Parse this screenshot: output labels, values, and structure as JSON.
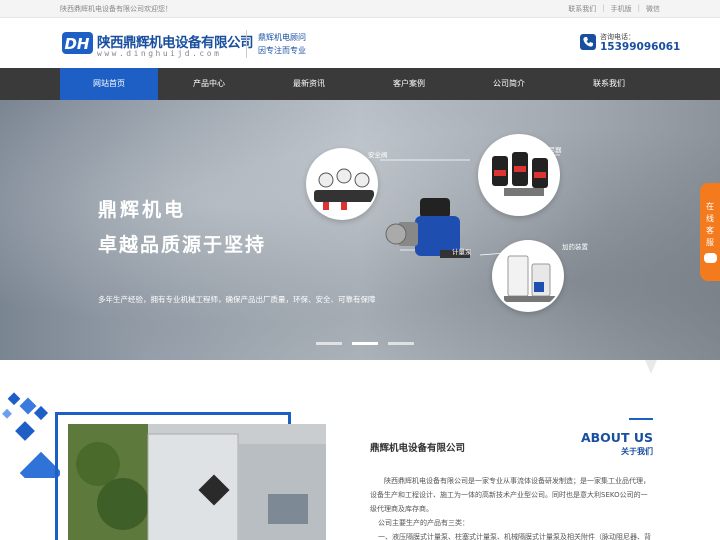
{
  "topbar": {
    "welcome": "陕西鼎辉机电设备有限公司欢迎您！",
    "links": [
      "联系我们",
      "手机版",
      "微信"
    ]
  },
  "header": {
    "brand_cn": "陕西鼎辉机电设备有限公司",
    "brand_en": "www.dinghuijd.com",
    "slogan_1": "鼎辉机电顾问",
    "slogan_2": "因专注而专业",
    "phone_label": "咨询电话：",
    "phone_number": "15399096061",
    "logo_letters": "DH"
  },
  "nav": {
    "items": [
      "网站首页",
      "产品中心",
      "最新资讯",
      "客户案例",
      "公司简介",
      "联系我们"
    ],
    "active_index": 0
  },
  "hero": {
    "title_1": "鼎辉机电",
    "title_2": "卓越品质源于坚持",
    "description": "多年生产经验，拥有专业机械工程师，确保产品出厂质量，环保、安全、可靠有保障",
    "labels": [
      "安全阀",
      "阻尼器",
      "计量泵",
      "加药装置"
    ],
    "slide_count": 3,
    "active_slide": 1
  },
  "side_tab": {
    "text": "在线客服"
  },
  "about": {
    "company_name": "鼎辉机电设备有限公司",
    "title_en": "ABOUT US",
    "title_cn": "关于我们",
    "paragraph_1": "陕西鼎辉机电设备有限公司是一家专业从事流体设备研发制造；是一家集工业品代理，设备生产和工程设计、施工为一体的高新技术产业型公司。同时也是意大利SEKO公司的一级代理商及库存商。",
    "paragraph_2": "公司主要生产的产品有三类：",
    "paragraph_3": "一、液压隔膜式计量泵、柱塞式计量泵、机械隔膜式计量泵及相关附件（脉动阻尼器、背"
  },
  "colors": {
    "brand_blue": "#1a4fa0",
    "nav_active": "#1e5fc6",
    "nav_bg": "#3a3a3a",
    "side_tab": "#f47a1e"
  }
}
